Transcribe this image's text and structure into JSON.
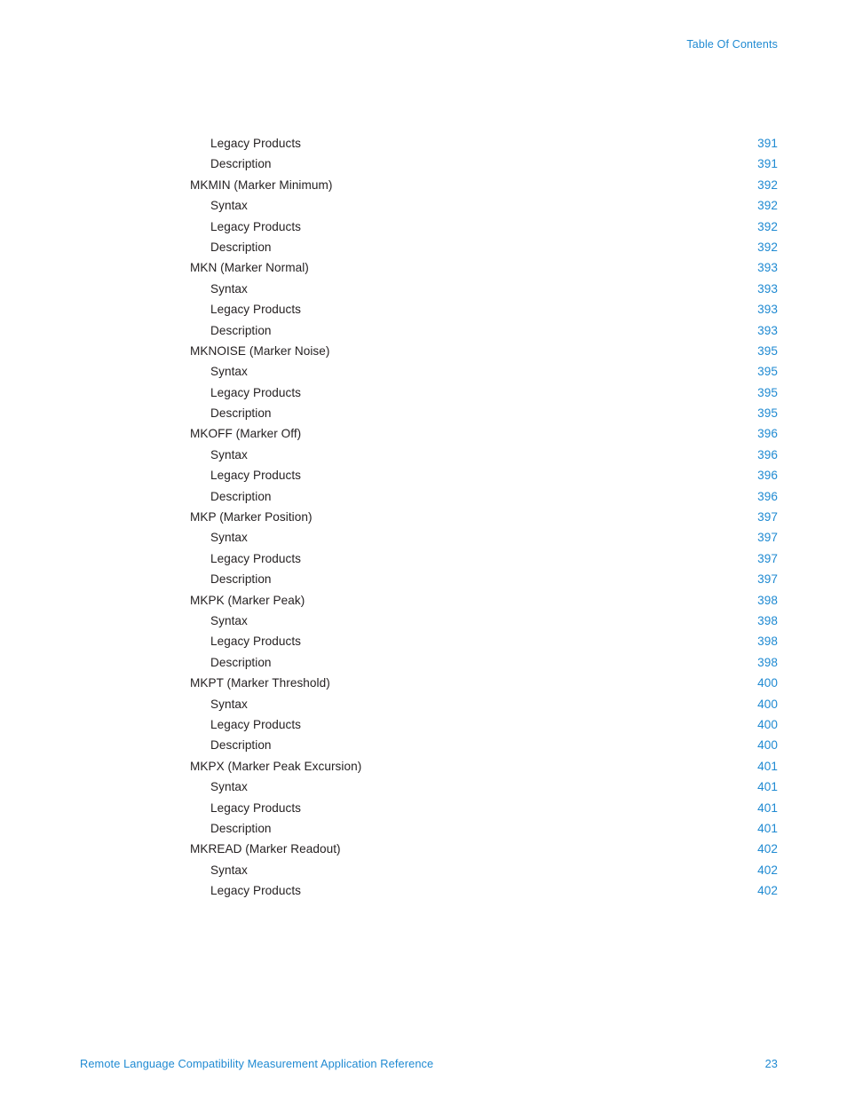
{
  "accent_color": "#1f8ad2",
  "text_color": "#231f20",
  "header": {
    "running_title": "Table Of Contents"
  },
  "footer": {
    "document_title": "Remote Language Compatibility Measurement Application Reference",
    "page_number": "23"
  },
  "toc": {
    "entries": [
      {
        "title": "Legacy Products",
        "page": "391",
        "level": 2
      },
      {
        "title": "Description",
        "page": "391",
        "level": 2
      },
      {
        "title": "MKMIN (Marker Minimum)",
        "page": "392",
        "level": 1
      },
      {
        "title": "Syntax",
        "page": "392",
        "level": 2
      },
      {
        "title": "Legacy Products",
        "page": "392",
        "level": 2
      },
      {
        "title": "Description",
        "page": "392",
        "level": 2
      },
      {
        "title": "MKN (Marker Normal)",
        "page": "393",
        "level": 1
      },
      {
        "title": "Syntax",
        "page": "393",
        "level": 2
      },
      {
        "title": "Legacy Products",
        "page": "393",
        "level": 2
      },
      {
        "title": "Description",
        "page": "393",
        "level": 2
      },
      {
        "title": "MKNOISE (Marker Noise)",
        "page": "395",
        "level": 1
      },
      {
        "title": "Syntax",
        "page": "395",
        "level": 2
      },
      {
        "title": "Legacy Products",
        "page": "395",
        "level": 2
      },
      {
        "title": "Description",
        "page": "395",
        "level": 2
      },
      {
        "title": "MKOFF (Marker Off)",
        "page": "396",
        "level": 1
      },
      {
        "title": "Syntax",
        "page": "396",
        "level": 2
      },
      {
        "title": "Legacy Products",
        "page": "396",
        "level": 2
      },
      {
        "title": "Description",
        "page": "396",
        "level": 2
      },
      {
        "title": "MKP (Marker Position)",
        "page": "397",
        "level": 1
      },
      {
        "title": "Syntax",
        "page": "397",
        "level": 2
      },
      {
        "title": "Legacy Products",
        "page": "397",
        "level": 2
      },
      {
        "title": "Description",
        "page": "397",
        "level": 2
      },
      {
        "title": "MKPK (Marker Peak)",
        "page": "398",
        "level": 1
      },
      {
        "title": "Syntax",
        "page": "398",
        "level": 2
      },
      {
        "title": "Legacy Products",
        "page": "398",
        "level": 2
      },
      {
        "title": "Description",
        "page": "398",
        "level": 2
      },
      {
        "title": "MKPT (Marker Threshold)",
        "page": "400",
        "level": 1
      },
      {
        "title": "Syntax",
        "page": "400",
        "level": 2
      },
      {
        "title": "Legacy Products",
        "page": "400",
        "level": 2
      },
      {
        "title": "Description",
        "page": "400",
        "level": 2
      },
      {
        "title": "MKPX (Marker Peak Excursion)",
        "page": "401",
        "level": 1
      },
      {
        "title": "Syntax",
        "page": "401",
        "level": 2
      },
      {
        "title": "Legacy Products",
        "page": "401",
        "level": 2
      },
      {
        "title": "Description",
        "page": "401",
        "level": 2
      },
      {
        "title": "MKREAD (Marker Readout)",
        "page": "402",
        "level": 1
      },
      {
        "title": "Syntax",
        "page": "402",
        "level": 2
      },
      {
        "title": "Legacy Products",
        "page": "402",
        "level": 2
      }
    ]
  }
}
